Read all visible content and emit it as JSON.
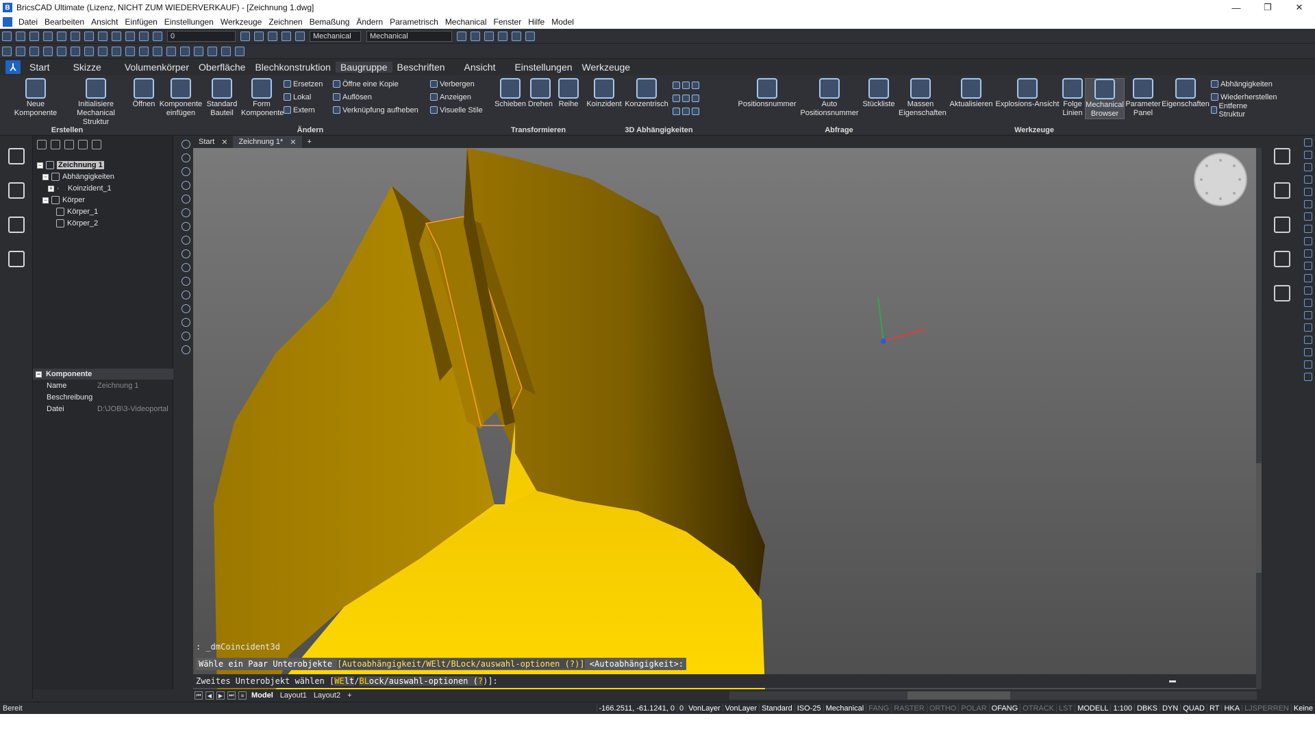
{
  "window": {
    "title": "BricsCAD Ultimate (Lizenz, NICHT ZUM WIEDERVERKAUF) - [Zeichnung 1.dwg]",
    "minimize": "—",
    "restore": "❐",
    "close": "✕"
  },
  "menu": [
    "Datei",
    "Bearbeiten",
    "Ansicht",
    "Einfügen",
    "Einstellungen",
    "Werkzeuge",
    "Zeichnen",
    "Bemaßung",
    "Ändern",
    "Parametrisch",
    "Mechanical",
    "Fenster",
    "Hilfe",
    "Model"
  ],
  "quick_access": {
    "layer_value": "0",
    "workspace_1": "Mechanical",
    "workspace_2": "Mechanical"
  },
  "ribbon_tabs": [
    "Start",
    "Skizze",
    "Volumenkörper",
    "Oberfläche",
    "Blechkonstruktion",
    "Baugruppe",
    "Beschriften",
    "Ansicht",
    "Einstellungen",
    "Werkzeuge"
  ],
  "ribbon": {
    "erstellen": {
      "label": "Erstellen",
      "neue": "Neue Komponente",
      "init": "Initialisiere Mechanical Struktur"
    },
    "aendern": {
      "label": "Ändern",
      "oeffnen": "Öffnen",
      "komp_einfuegen": "Komponente einfügen",
      "standard": "Standard Bauteil",
      "form": "Form Komponente",
      "ersetzen": "Ersetzen",
      "lokal": "Lokal",
      "extern": "Extern",
      "kopie": "Öffne eine Kopie",
      "aufloesen": "Auflösen",
      "verkn": "Verknüpfung aufheben",
      "verbergen": "Verbergen",
      "anzeigen": "Anzeigen",
      "visuelle": "Visuelle Stile"
    },
    "transformieren": {
      "label": "Transformieren",
      "schieben": "Schieben",
      "drehen": "Drehen",
      "reihe": "Reihe"
    },
    "abhaengigkeiten": {
      "label": "3D Abhängigkeiten",
      "koinzident": "Koinzident",
      "konzentrisch": "Konzentrisch"
    },
    "abfrage": {
      "label": "Abfrage",
      "positionsnummer": "Positionsnummer",
      "auto_pos": "Auto Positionsnummer",
      "stueckliste": "Stückliste",
      "massen": "Massen Eigenschaften"
    },
    "werkzeuge": {
      "label": "Werkzeuge",
      "aktualisieren": "Aktualisieren",
      "explosion": "Explosions-Ansicht",
      "folge": "Folge Linien",
      "browser": "Mechanical Browser",
      "parameter": "Parameter Panel",
      "eigenschaften": "Eigenschaften",
      "abh": "Abhängigkeiten",
      "wiederherstellen": "Wiederherstellen",
      "entferne": "Entferne Struktur"
    }
  },
  "tree": {
    "root": "Zeichnung 1",
    "abh": "Abhängigkeiten",
    "koinz": "Koinzident_1",
    "koerper": "Körper",
    "k1": "Körper_1",
    "k2": "Körper_2"
  },
  "props": {
    "header": "Komponente",
    "rows": [
      {
        "k": "Name",
        "v": "Zeichnung 1"
      },
      {
        "k": "Beschreibung",
        "v": ""
      },
      {
        "k": "Datei",
        "v": "D:\\JOB\\3-Videoportal"
      }
    ]
  },
  "doc_tabs": {
    "start": "Start",
    "drawing": "Zeichnung 1*",
    "close": "✕",
    "add": "+"
  },
  "command": {
    "line1": ": _dmCoincident3d",
    "line2_prefix": "Wähle ein Paar Unterobjekte ",
    "line2_options": "[Autoabhängigkeit/WElt/BLock/auswahl-optionen (?)]",
    "line2_suffix": " <Autoabhängigkeit>:",
    "line3_prefix": "Zweites Unterobjekt wählen [",
    "opt_we": "WE",
    "opt_we_rest": "lt",
    "opt_bl": "BL",
    "opt_bl_rest": "ock",
    "opt_rest": "/auswahl-optionen (",
    "opt_q": "?",
    "line3_suffix": ")]:"
  },
  "layout_tabs": [
    "Model",
    "Layout1",
    "Layout2"
  ],
  "layout_add": "+",
  "status": {
    "ready": "Bereit",
    "coords": "-166.2511, -61.1241, 0",
    "items": [
      {
        "t": "0",
        "on": true
      },
      {
        "t": "VonLayer",
        "on": true
      },
      {
        "t": "VonLayer",
        "on": true
      },
      {
        "t": "Standard",
        "on": true
      },
      {
        "t": "ISO-25",
        "on": true
      },
      {
        "t": "Mechanical",
        "on": true
      },
      {
        "t": "FANG",
        "on": false
      },
      {
        "t": "RASTER",
        "on": false
      },
      {
        "t": "ORTHO",
        "on": false
      },
      {
        "t": "POLAR",
        "on": false
      },
      {
        "t": "OFANG",
        "on": true
      },
      {
        "t": "OTRACK",
        "on": false
      },
      {
        "t": "LST",
        "on": false
      },
      {
        "t": "MODELL",
        "on": true
      },
      {
        "t": "1:100",
        "on": true
      },
      {
        "t": "DBKS",
        "on": true
      },
      {
        "t": "DYN",
        "on": true
      },
      {
        "t": "QUAD",
        "on": true
      },
      {
        "t": "RT",
        "on": true
      },
      {
        "t": "HKA",
        "on": true
      },
      {
        "t": "LJSPERREN",
        "on": false
      },
      {
        "t": "Keine",
        "on": true
      }
    ]
  },
  "colors": {
    "accent": "#1e63c6",
    "part_dark": "#8a6a00",
    "part_mid": "#b58a00",
    "part_bright": "#ffd400",
    "selection_edge": "#ff9a2e"
  }
}
